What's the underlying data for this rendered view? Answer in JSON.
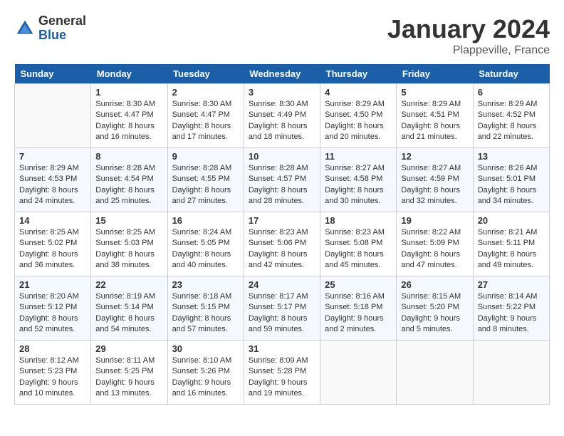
{
  "header": {
    "logo_general": "General",
    "logo_blue": "Blue",
    "month_title": "January 2024",
    "location": "Plappeville, France"
  },
  "calendar": {
    "days_of_week": [
      "Sunday",
      "Monday",
      "Tuesday",
      "Wednesday",
      "Thursday",
      "Friday",
      "Saturday"
    ],
    "weeks": [
      [
        {
          "day": "",
          "info": ""
        },
        {
          "day": "1",
          "info": "Sunrise: 8:30 AM\nSunset: 4:47 PM\nDaylight: 8 hours\nand 16 minutes."
        },
        {
          "day": "2",
          "info": "Sunrise: 8:30 AM\nSunset: 4:47 PM\nDaylight: 8 hours\nand 17 minutes."
        },
        {
          "day": "3",
          "info": "Sunrise: 8:30 AM\nSunset: 4:49 PM\nDaylight: 8 hours\nand 18 minutes."
        },
        {
          "day": "4",
          "info": "Sunrise: 8:29 AM\nSunset: 4:50 PM\nDaylight: 8 hours\nand 20 minutes."
        },
        {
          "day": "5",
          "info": "Sunrise: 8:29 AM\nSunset: 4:51 PM\nDaylight: 8 hours\nand 21 minutes."
        },
        {
          "day": "6",
          "info": "Sunrise: 8:29 AM\nSunset: 4:52 PM\nDaylight: 8 hours\nand 22 minutes."
        }
      ],
      [
        {
          "day": "7",
          "info": "Sunrise: 8:29 AM\nSunset: 4:53 PM\nDaylight: 8 hours\nand 24 minutes."
        },
        {
          "day": "8",
          "info": "Sunrise: 8:28 AM\nSunset: 4:54 PM\nDaylight: 8 hours\nand 25 minutes."
        },
        {
          "day": "9",
          "info": "Sunrise: 8:28 AM\nSunset: 4:55 PM\nDaylight: 8 hours\nand 27 minutes."
        },
        {
          "day": "10",
          "info": "Sunrise: 8:28 AM\nSunset: 4:57 PM\nDaylight: 8 hours\nand 28 minutes."
        },
        {
          "day": "11",
          "info": "Sunrise: 8:27 AM\nSunset: 4:58 PM\nDaylight: 8 hours\nand 30 minutes."
        },
        {
          "day": "12",
          "info": "Sunrise: 8:27 AM\nSunset: 4:59 PM\nDaylight: 8 hours\nand 32 minutes."
        },
        {
          "day": "13",
          "info": "Sunrise: 8:26 AM\nSunset: 5:01 PM\nDaylight: 8 hours\nand 34 minutes."
        }
      ],
      [
        {
          "day": "14",
          "info": "Sunrise: 8:25 AM\nSunset: 5:02 PM\nDaylight: 8 hours\nand 36 minutes."
        },
        {
          "day": "15",
          "info": "Sunrise: 8:25 AM\nSunset: 5:03 PM\nDaylight: 8 hours\nand 38 minutes."
        },
        {
          "day": "16",
          "info": "Sunrise: 8:24 AM\nSunset: 5:05 PM\nDaylight: 8 hours\nand 40 minutes."
        },
        {
          "day": "17",
          "info": "Sunrise: 8:23 AM\nSunset: 5:06 PM\nDaylight: 8 hours\nand 42 minutes."
        },
        {
          "day": "18",
          "info": "Sunrise: 8:23 AM\nSunset: 5:08 PM\nDaylight: 8 hours\nand 45 minutes."
        },
        {
          "day": "19",
          "info": "Sunrise: 8:22 AM\nSunset: 5:09 PM\nDaylight: 8 hours\nand 47 minutes."
        },
        {
          "day": "20",
          "info": "Sunrise: 8:21 AM\nSunset: 5:11 PM\nDaylight: 8 hours\nand 49 minutes."
        }
      ],
      [
        {
          "day": "21",
          "info": "Sunrise: 8:20 AM\nSunset: 5:12 PM\nDaylight: 8 hours\nand 52 minutes."
        },
        {
          "day": "22",
          "info": "Sunrise: 8:19 AM\nSunset: 5:14 PM\nDaylight: 8 hours\nand 54 minutes."
        },
        {
          "day": "23",
          "info": "Sunrise: 8:18 AM\nSunset: 5:15 PM\nDaylight: 8 hours\nand 57 minutes."
        },
        {
          "day": "24",
          "info": "Sunrise: 8:17 AM\nSunset: 5:17 PM\nDaylight: 8 hours\nand 59 minutes."
        },
        {
          "day": "25",
          "info": "Sunrise: 8:16 AM\nSunset: 5:18 PM\nDaylight: 9 hours\nand 2 minutes."
        },
        {
          "day": "26",
          "info": "Sunrise: 8:15 AM\nSunset: 5:20 PM\nDaylight: 9 hours\nand 5 minutes."
        },
        {
          "day": "27",
          "info": "Sunrise: 8:14 AM\nSunset: 5:22 PM\nDaylight: 9 hours\nand 8 minutes."
        }
      ],
      [
        {
          "day": "28",
          "info": "Sunrise: 8:12 AM\nSunset: 5:23 PM\nDaylight: 9 hours\nand 10 minutes."
        },
        {
          "day": "29",
          "info": "Sunrise: 8:11 AM\nSunset: 5:25 PM\nDaylight: 9 hours\nand 13 minutes."
        },
        {
          "day": "30",
          "info": "Sunrise: 8:10 AM\nSunset: 5:26 PM\nDaylight: 9 hours\nand 16 minutes."
        },
        {
          "day": "31",
          "info": "Sunrise: 8:09 AM\nSunset: 5:28 PM\nDaylight: 9 hours\nand 19 minutes."
        },
        {
          "day": "",
          "info": ""
        },
        {
          "day": "",
          "info": ""
        },
        {
          "day": "",
          "info": ""
        }
      ]
    ]
  }
}
